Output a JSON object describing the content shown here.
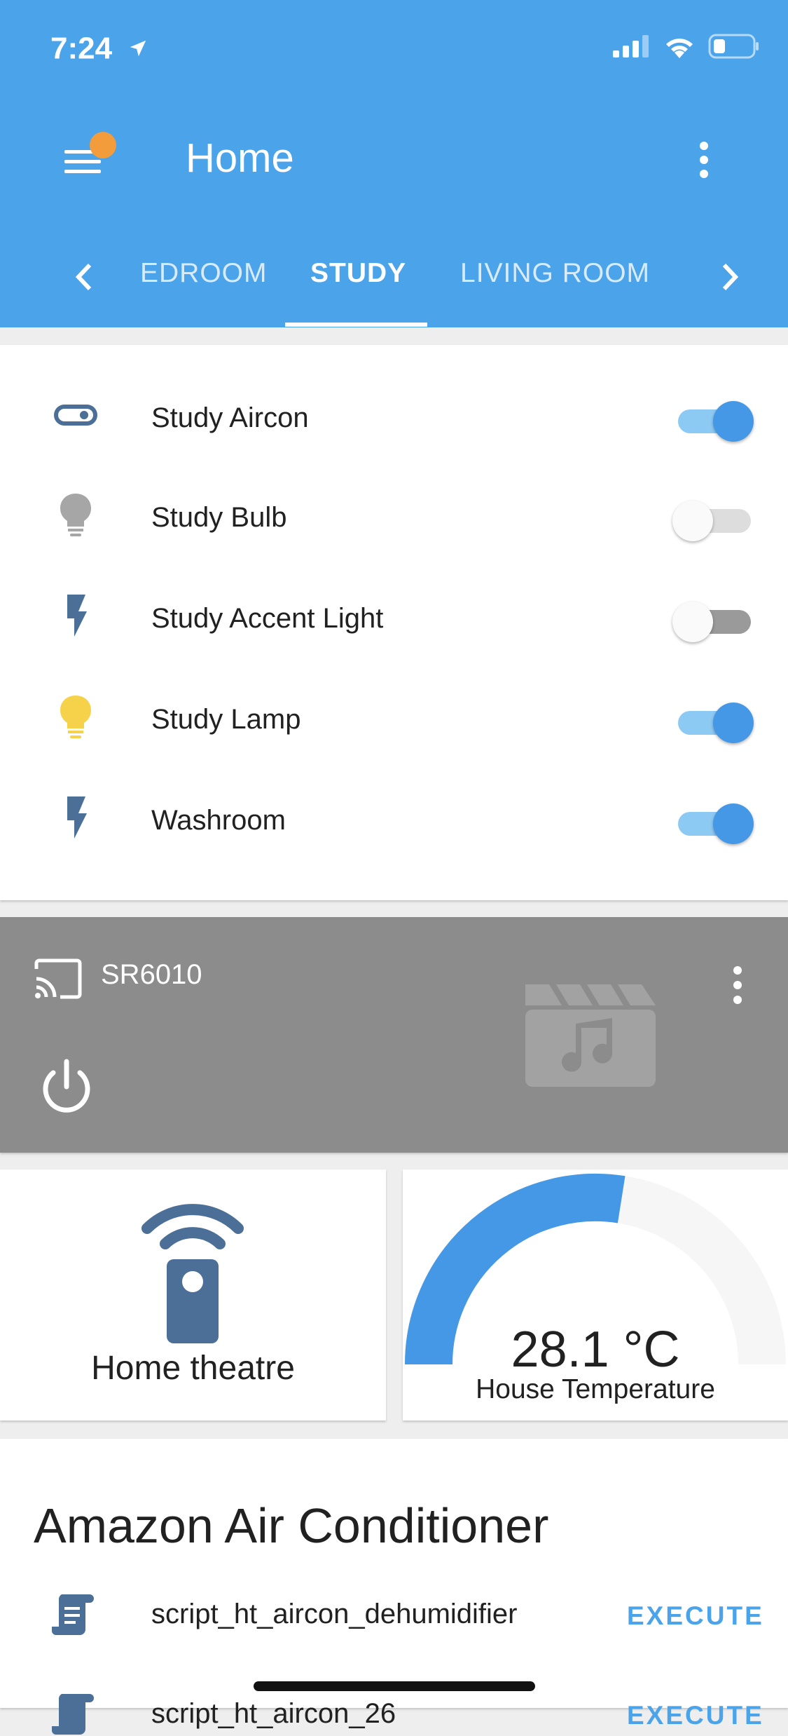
{
  "status_bar": {
    "time": "7:24"
  },
  "header": {
    "title": "Home"
  },
  "tabs": [
    {
      "label": "EDROOM"
    },
    {
      "label": "STUDY"
    },
    {
      "label": "LIVING ROOM"
    }
  ],
  "entities": [
    {
      "label": "Study Aircon",
      "icon": "toggle-switch-icon",
      "state": "on"
    },
    {
      "label": "Study Bulb",
      "icon": "bulb-icon",
      "state": "off"
    },
    {
      "label": "Study Accent Light",
      "icon": "flash-icon",
      "state": "off"
    },
    {
      "label": "Study Lamp",
      "icon": "bulb-icon",
      "state": "on"
    },
    {
      "label": "Washroom",
      "icon": "flash-icon",
      "state": "on"
    }
  ],
  "media_player": {
    "name": "SR6010"
  },
  "remote_card": {
    "label": "Home theatre"
  },
  "temperature_card": {
    "value": "28.1 °C",
    "label": "House Temperature",
    "gauge_fill": 0.55
  },
  "ac_card": {
    "title": "Amazon Air Conditioner",
    "scripts": [
      {
        "name": "script_ht_aircon_dehumidifier",
        "action": "EXECUTE"
      },
      {
        "name": "script_ht_aircon_26",
        "action": "EXECUTE"
      }
    ]
  },
  "colors": {
    "header": "#4ba3ea",
    "accent": "#4598e6",
    "icon_blue": "#4c6f97",
    "bulb_on": "#f6d14a",
    "bulb_off": "#a6a6a6",
    "notification": "#f39c3b"
  }
}
